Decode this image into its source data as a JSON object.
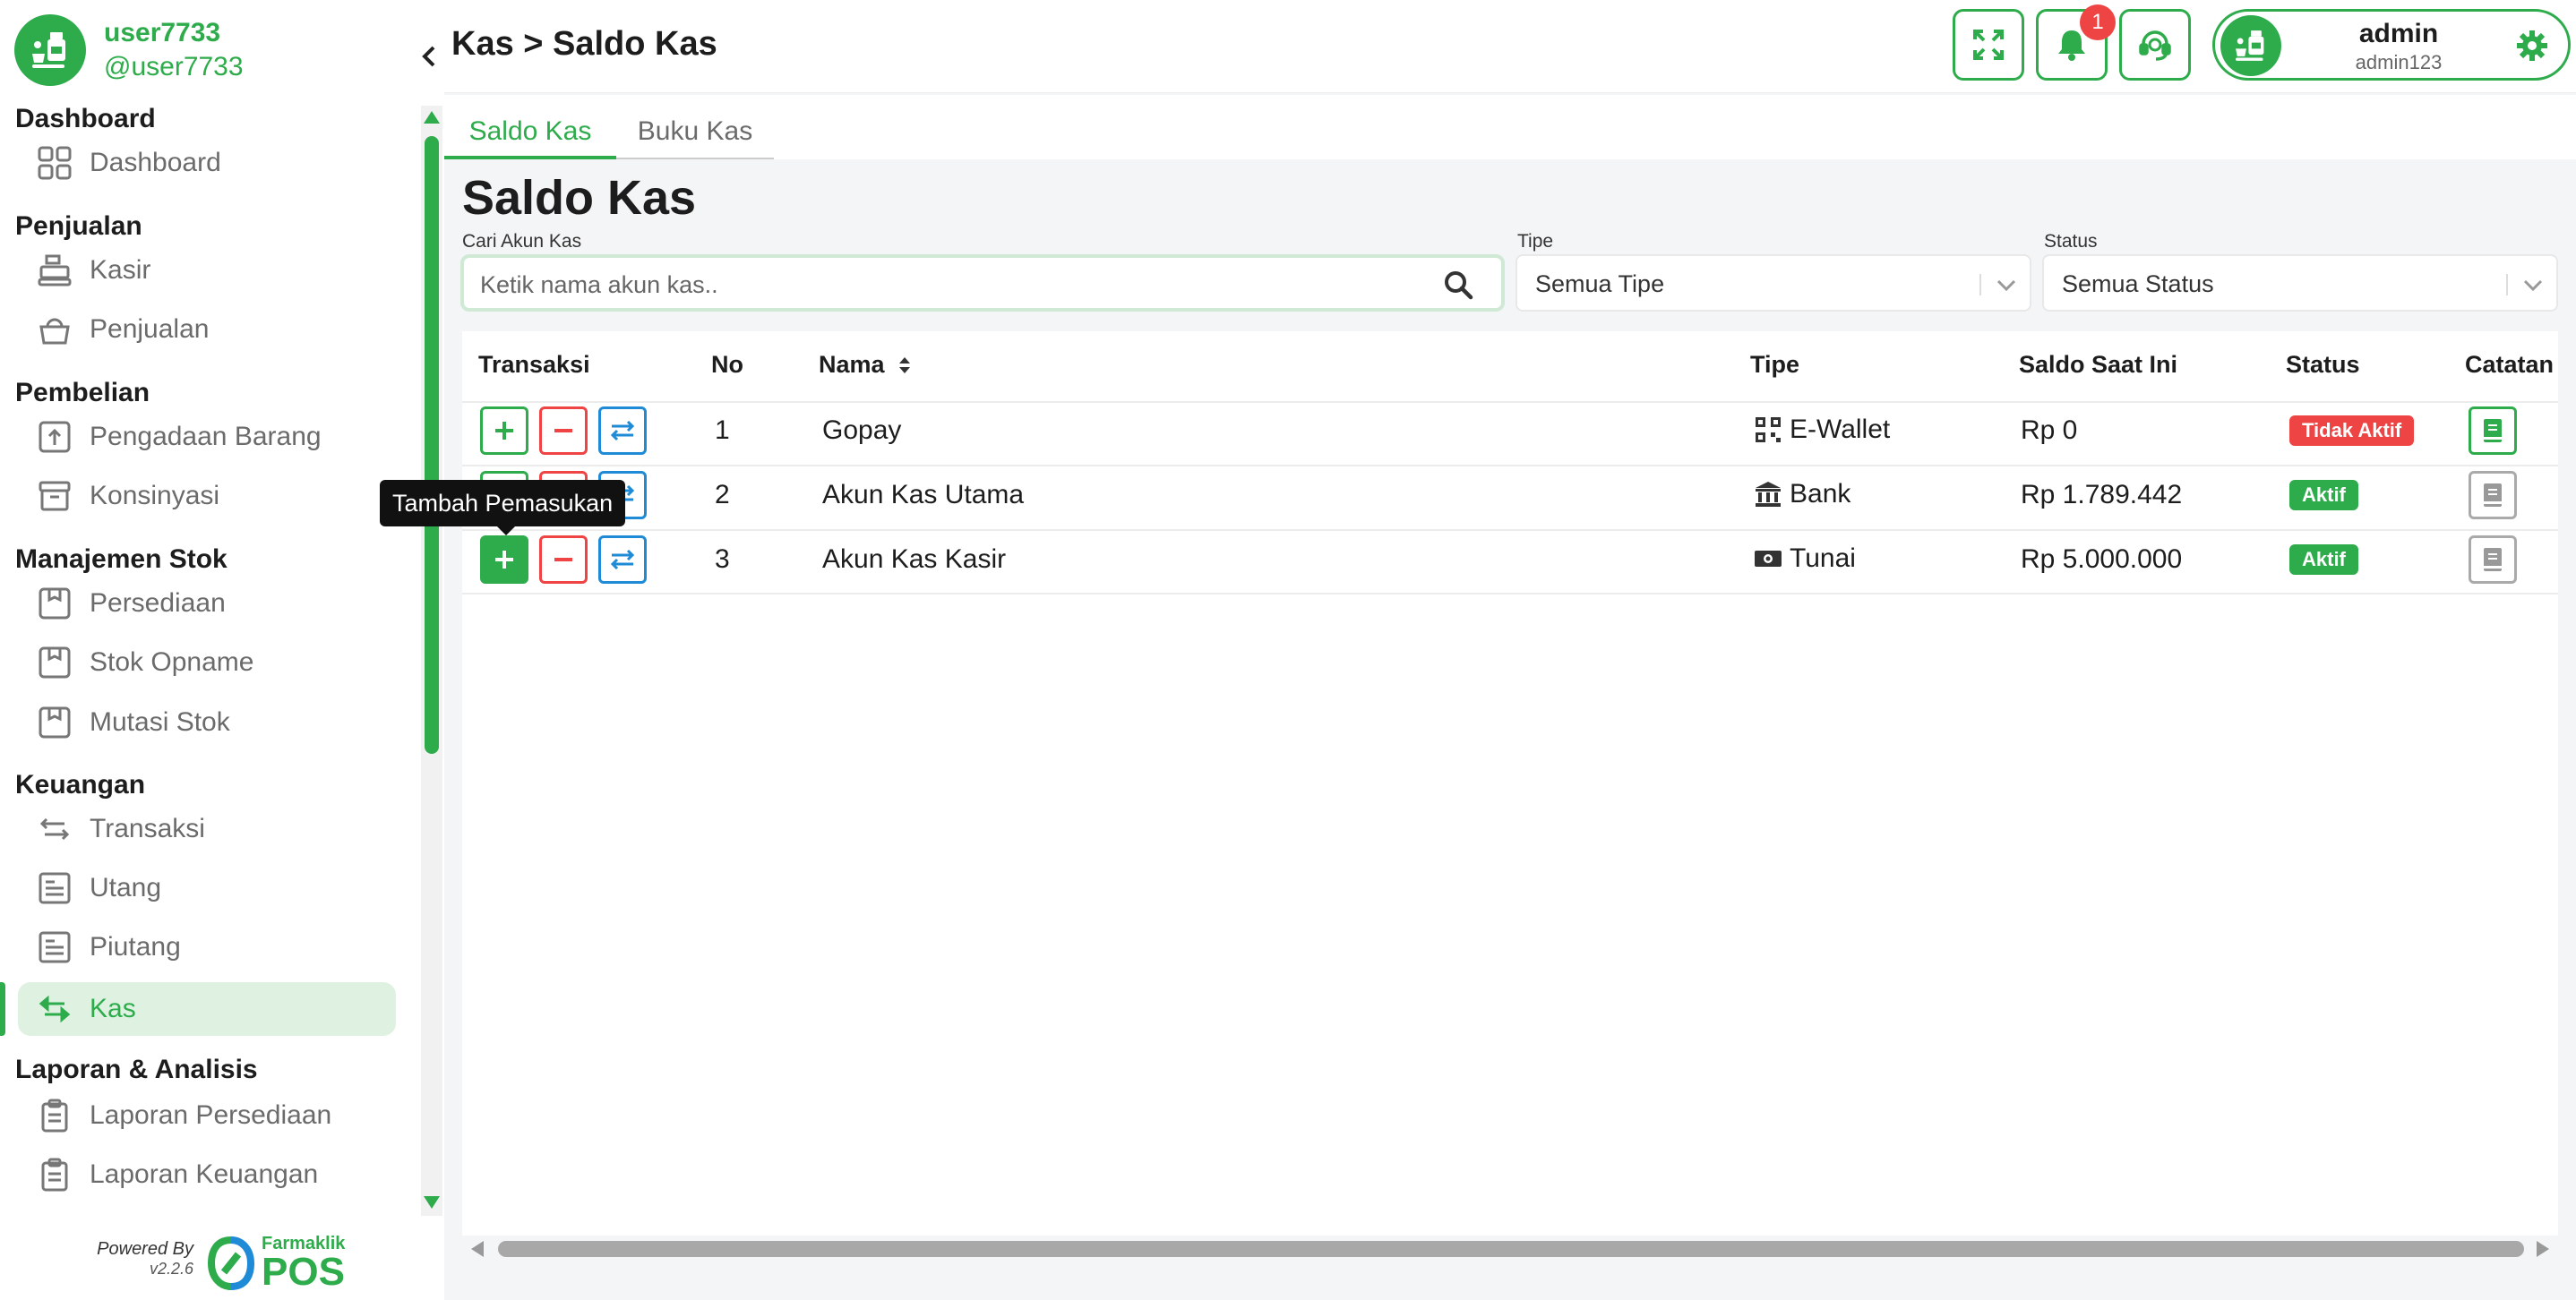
{
  "user": {
    "name": "user7733",
    "handle": "@user7733"
  },
  "sidebar": {
    "sections": [
      {
        "title": "Dashboard",
        "items": [
          {
            "label": "Dashboard",
            "icon": "grid-icon"
          }
        ]
      },
      {
        "title": "Penjualan",
        "items": [
          {
            "label": "Kasir",
            "icon": "cash-register-icon"
          },
          {
            "label": "Penjualan",
            "icon": "basket-icon"
          }
        ]
      },
      {
        "title": "Pembelian",
        "items": [
          {
            "label": "Pengadaan Barang",
            "icon": "upload-box-icon"
          },
          {
            "label": "Konsinyasi",
            "icon": "archive-icon"
          }
        ]
      },
      {
        "title": "Manajemen Stok",
        "items": [
          {
            "label": "Persediaan",
            "icon": "box-icon"
          },
          {
            "label": "Stok Opname",
            "icon": "box-icon"
          },
          {
            "label": "Mutasi Stok",
            "icon": "box-icon"
          }
        ]
      },
      {
        "title": "Keuangan",
        "items": [
          {
            "label": "Transaksi",
            "icon": "transfer-icon"
          },
          {
            "label": "Utang",
            "icon": "receipt-icon"
          },
          {
            "label": "Piutang",
            "icon": "receipt-icon"
          },
          {
            "label": "Kas",
            "icon": "transfer-icon",
            "active": true
          }
        ]
      },
      {
        "title": "Laporan & Analisis",
        "items": [
          {
            "label": "Laporan Persediaan",
            "icon": "clipboard-icon"
          },
          {
            "label": "Laporan Keuangan",
            "icon": "clipboard-icon"
          }
        ]
      }
    ],
    "powered_by": "Powered By",
    "version": "v2.2.6",
    "brand_small": "Farmaklik",
    "brand_big": "POS"
  },
  "header": {
    "breadcrumb": "Kas > Saldo Kas",
    "notification_count": "1",
    "profile_name": "admin",
    "profile_username": "admin123"
  },
  "tabs": [
    {
      "label": "Saldo Kas",
      "active": true
    },
    {
      "label": "Buku Kas",
      "active": false
    }
  ],
  "main": {
    "title": "Saldo Kas",
    "search": {
      "label": "Cari Akun Kas",
      "placeholder": "Ketik nama akun kas..",
      "value": ""
    },
    "type_filter": {
      "label": "Tipe",
      "value": "Semua Tipe"
    },
    "status_filter": {
      "label": "Status",
      "value": "Semua Status"
    }
  },
  "table": {
    "columns": [
      "Transaksi",
      "No",
      "Nama",
      "Tipe",
      "Saldo Saat Ini",
      "Status",
      "Catatan"
    ],
    "rows": [
      {
        "no": "1",
        "nama": "Gopay",
        "tipe": "E-Wallet",
        "tipe_icon": "qr-code-icon",
        "saldo": "Rp 0",
        "status": "Tidak Aktif",
        "status_color": "#ef4444",
        "note_icon": "book-icon"
      },
      {
        "no": "2",
        "nama": "Akun Kas Utama",
        "tipe": "Bank",
        "tipe_icon": "bank-icon",
        "saldo": "Rp 1.789.442",
        "status": "Aktif",
        "status_color": "#2eac4b",
        "note_icon": "book-icon"
      },
      {
        "no": "3",
        "nama": "Akun Kas Kasir",
        "tipe": "Tunai",
        "tipe_icon": "cash-icon",
        "saldo": "Rp 5.000.000",
        "status": "Aktif",
        "status_color": "#2eac4b",
        "note_icon": "book-icon"
      }
    ]
  },
  "tooltip": {
    "text": "Tambah Pemasukan"
  },
  "colors": {
    "accent": "#2eac4b",
    "danger": "#ef4444",
    "info": "#1f8ad6"
  }
}
